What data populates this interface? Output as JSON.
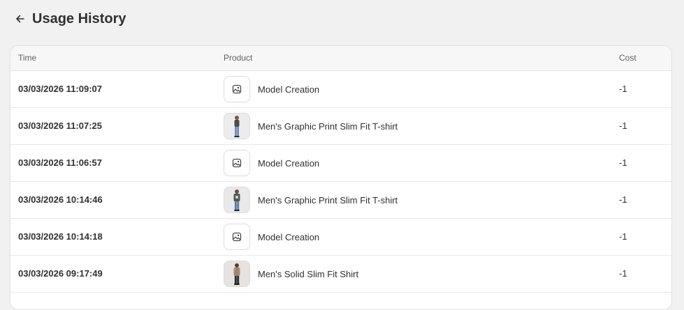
{
  "page": {
    "title": "Usage History",
    "back_icon": "arrow-left-icon"
  },
  "table": {
    "columns": {
      "time": "Time",
      "product": "Product",
      "cost": "Cost"
    },
    "rows": [
      {
        "time": "03/03/2026 11:09:07",
        "product": "Model Creation",
        "thumb": "image-placeholder-icon",
        "cost": "-1"
      },
      {
        "time": "03/03/2026 11:07:25",
        "product": "Men's Graphic Print Slim Fit T-shirt",
        "thumb": "product-photo",
        "cost": "-1"
      },
      {
        "time": "03/03/2026 11:06:57",
        "product": "Model Creation",
        "thumb": "image-placeholder-icon",
        "cost": "-1"
      },
      {
        "time": "03/03/2026 10:14:46",
        "product": "Men's Graphic Print Slim Fit T-shirt",
        "thumb": "product-photo",
        "cost": "-1"
      },
      {
        "time": "03/03/2026 10:14:18",
        "product": "Model Creation",
        "thumb": "image-placeholder-icon",
        "cost": "-1"
      },
      {
        "time": "03/03/2026 09:17:49",
        "product": "Men's Solid Slim Fit Shirt",
        "thumb": "product-photo",
        "cost": "-1"
      }
    ]
  },
  "colors": {
    "background": "#f1f1f1",
    "card": "#ffffff",
    "text": "#303030",
    "muted": "#616161"
  }
}
